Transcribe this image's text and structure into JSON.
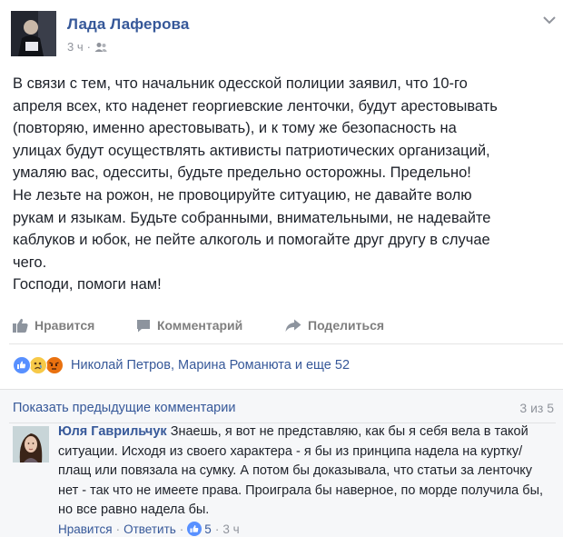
{
  "post": {
    "author": "Лада Лаферова",
    "time": "3 ч",
    "privacy_icon": "friends-icon",
    "text": "В связи с тем, что начальник одесской полиции заявил, что 10-го\nапреля всех, кто наденет георгиевские ленточки, будут арестовывать\n(повторяю, именно арестовывать), и к тому же безопасность на\nулицах будут осуществлять активисты патриотических организаций,\nумаляю вас, одесситы, будьте предельно осторожны. Предельно!\nНе лезьте на рожон, не провоцируйте ситуацию, не давайте волю\nрукам и языкам. Будьте собранными, внимательными, не надевайте\nкаблуков и юбок, не пейте алкоголь и помогайте друг другу в случае\nчего.\nГосподи, помоги нам!"
  },
  "actions": {
    "like": "Нравится",
    "comment": "Комментарий",
    "share": "Поделиться"
  },
  "reactions": {
    "names": "Николай Петров, Марина Романюта и еще 52",
    "icons": [
      "like-reaction-icon",
      "sad-reaction-icon",
      "angry-reaction-icon"
    ]
  },
  "comments": {
    "show_previous": "Показать предыдущие комментарии",
    "count": "3 из 5",
    "items": [
      {
        "author": "Юля Гаврильчук",
        "text": "Знаешь, я вот не представляю, как бы я себя вела в такой ситуации. Исходя из своего характера - я бы из принципа надела на куртку/плащ или повязала на сумку. А потом бы доказывала, что статьи за ленточку нет - так что не имеете права. Проиграла бы наверное, по морде получила бы, но все равно надела бы.",
        "like": "Нравится",
        "reply": "Ответить",
        "likes": "5",
        "time": "3 ч"
      }
    ]
  },
  "colors": {
    "link": "#365899",
    "muted": "#90949c",
    "like_blue": "#5890ff",
    "sad_yellow": "#f7c948",
    "angry_red": "#e9710f"
  }
}
